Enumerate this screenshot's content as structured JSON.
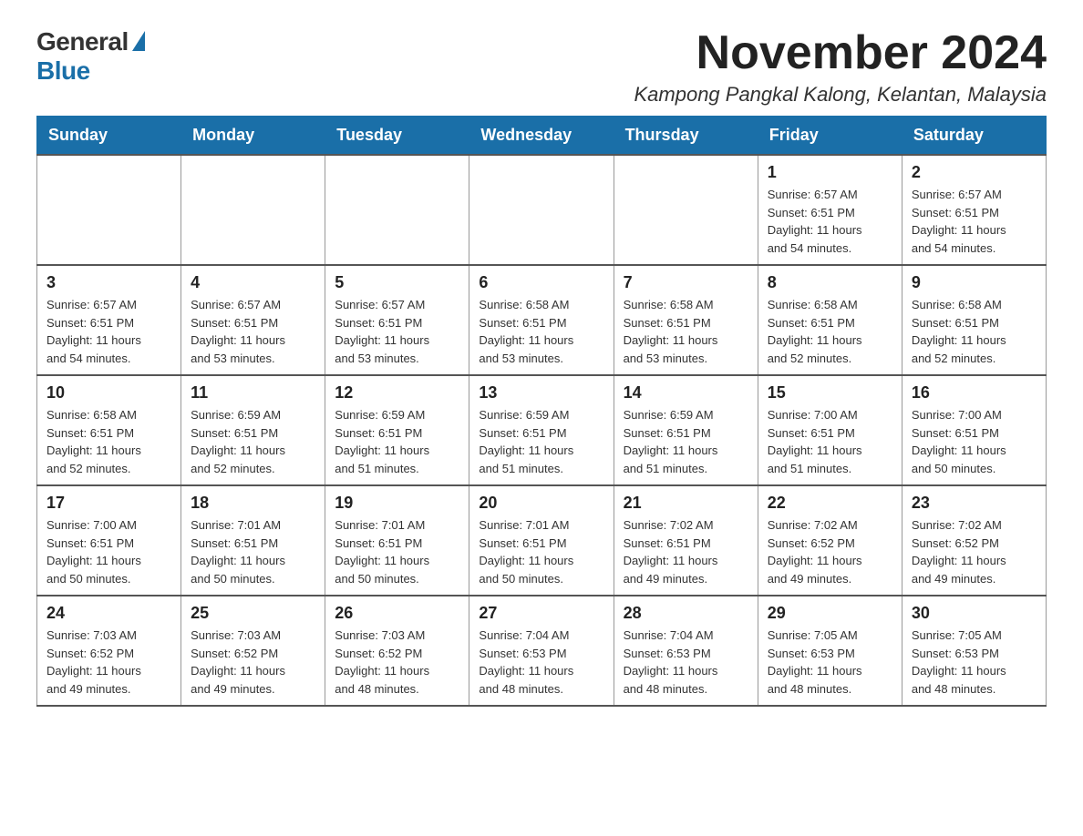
{
  "logo": {
    "general": "General",
    "blue": "Blue"
  },
  "header": {
    "month": "November 2024",
    "location": "Kampong Pangkal Kalong, Kelantan, Malaysia"
  },
  "weekdays": [
    "Sunday",
    "Monday",
    "Tuesday",
    "Wednesday",
    "Thursday",
    "Friday",
    "Saturday"
  ],
  "weeks": [
    [
      {
        "day": "",
        "info": ""
      },
      {
        "day": "",
        "info": ""
      },
      {
        "day": "",
        "info": ""
      },
      {
        "day": "",
        "info": ""
      },
      {
        "day": "",
        "info": ""
      },
      {
        "day": "1",
        "info": "Sunrise: 6:57 AM\nSunset: 6:51 PM\nDaylight: 11 hours\nand 54 minutes."
      },
      {
        "day": "2",
        "info": "Sunrise: 6:57 AM\nSunset: 6:51 PM\nDaylight: 11 hours\nand 54 minutes."
      }
    ],
    [
      {
        "day": "3",
        "info": "Sunrise: 6:57 AM\nSunset: 6:51 PM\nDaylight: 11 hours\nand 54 minutes."
      },
      {
        "day": "4",
        "info": "Sunrise: 6:57 AM\nSunset: 6:51 PM\nDaylight: 11 hours\nand 53 minutes."
      },
      {
        "day": "5",
        "info": "Sunrise: 6:57 AM\nSunset: 6:51 PM\nDaylight: 11 hours\nand 53 minutes."
      },
      {
        "day": "6",
        "info": "Sunrise: 6:58 AM\nSunset: 6:51 PM\nDaylight: 11 hours\nand 53 minutes."
      },
      {
        "day": "7",
        "info": "Sunrise: 6:58 AM\nSunset: 6:51 PM\nDaylight: 11 hours\nand 53 minutes."
      },
      {
        "day": "8",
        "info": "Sunrise: 6:58 AM\nSunset: 6:51 PM\nDaylight: 11 hours\nand 52 minutes."
      },
      {
        "day": "9",
        "info": "Sunrise: 6:58 AM\nSunset: 6:51 PM\nDaylight: 11 hours\nand 52 minutes."
      }
    ],
    [
      {
        "day": "10",
        "info": "Sunrise: 6:58 AM\nSunset: 6:51 PM\nDaylight: 11 hours\nand 52 minutes."
      },
      {
        "day": "11",
        "info": "Sunrise: 6:59 AM\nSunset: 6:51 PM\nDaylight: 11 hours\nand 52 minutes."
      },
      {
        "day": "12",
        "info": "Sunrise: 6:59 AM\nSunset: 6:51 PM\nDaylight: 11 hours\nand 51 minutes."
      },
      {
        "day": "13",
        "info": "Sunrise: 6:59 AM\nSunset: 6:51 PM\nDaylight: 11 hours\nand 51 minutes."
      },
      {
        "day": "14",
        "info": "Sunrise: 6:59 AM\nSunset: 6:51 PM\nDaylight: 11 hours\nand 51 minutes."
      },
      {
        "day": "15",
        "info": "Sunrise: 7:00 AM\nSunset: 6:51 PM\nDaylight: 11 hours\nand 51 minutes."
      },
      {
        "day": "16",
        "info": "Sunrise: 7:00 AM\nSunset: 6:51 PM\nDaylight: 11 hours\nand 50 minutes."
      }
    ],
    [
      {
        "day": "17",
        "info": "Sunrise: 7:00 AM\nSunset: 6:51 PM\nDaylight: 11 hours\nand 50 minutes."
      },
      {
        "day": "18",
        "info": "Sunrise: 7:01 AM\nSunset: 6:51 PM\nDaylight: 11 hours\nand 50 minutes."
      },
      {
        "day": "19",
        "info": "Sunrise: 7:01 AM\nSunset: 6:51 PM\nDaylight: 11 hours\nand 50 minutes."
      },
      {
        "day": "20",
        "info": "Sunrise: 7:01 AM\nSunset: 6:51 PM\nDaylight: 11 hours\nand 50 minutes."
      },
      {
        "day": "21",
        "info": "Sunrise: 7:02 AM\nSunset: 6:51 PM\nDaylight: 11 hours\nand 49 minutes."
      },
      {
        "day": "22",
        "info": "Sunrise: 7:02 AM\nSunset: 6:52 PM\nDaylight: 11 hours\nand 49 minutes."
      },
      {
        "day": "23",
        "info": "Sunrise: 7:02 AM\nSunset: 6:52 PM\nDaylight: 11 hours\nand 49 minutes."
      }
    ],
    [
      {
        "day": "24",
        "info": "Sunrise: 7:03 AM\nSunset: 6:52 PM\nDaylight: 11 hours\nand 49 minutes."
      },
      {
        "day": "25",
        "info": "Sunrise: 7:03 AM\nSunset: 6:52 PM\nDaylight: 11 hours\nand 49 minutes."
      },
      {
        "day": "26",
        "info": "Sunrise: 7:03 AM\nSunset: 6:52 PM\nDaylight: 11 hours\nand 48 minutes."
      },
      {
        "day": "27",
        "info": "Sunrise: 7:04 AM\nSunset: 6:53 PM\nDaylight: 11 hours\nand 48 minutes."
      },
      {
        "day": "28",
        "info": "Sunrise: 7:04 AM\nSunset: 6:53 PM\nDaylight: 11 hours\nand 48 minutes."
      },
      {
        "day": "29",
        "info": "Sunrise: 7:05 AM\nSunset: 6:53 PM\nDaylight: 11 hours\nand 48 minutes."
      },
      {
        "day": "30",
        "info": "Sunrise: 7:05 AM\nSunset: 6:53 PM\nDaylight: 11 hours\nand 48 minutes."
      }
    ]
  ]
}
